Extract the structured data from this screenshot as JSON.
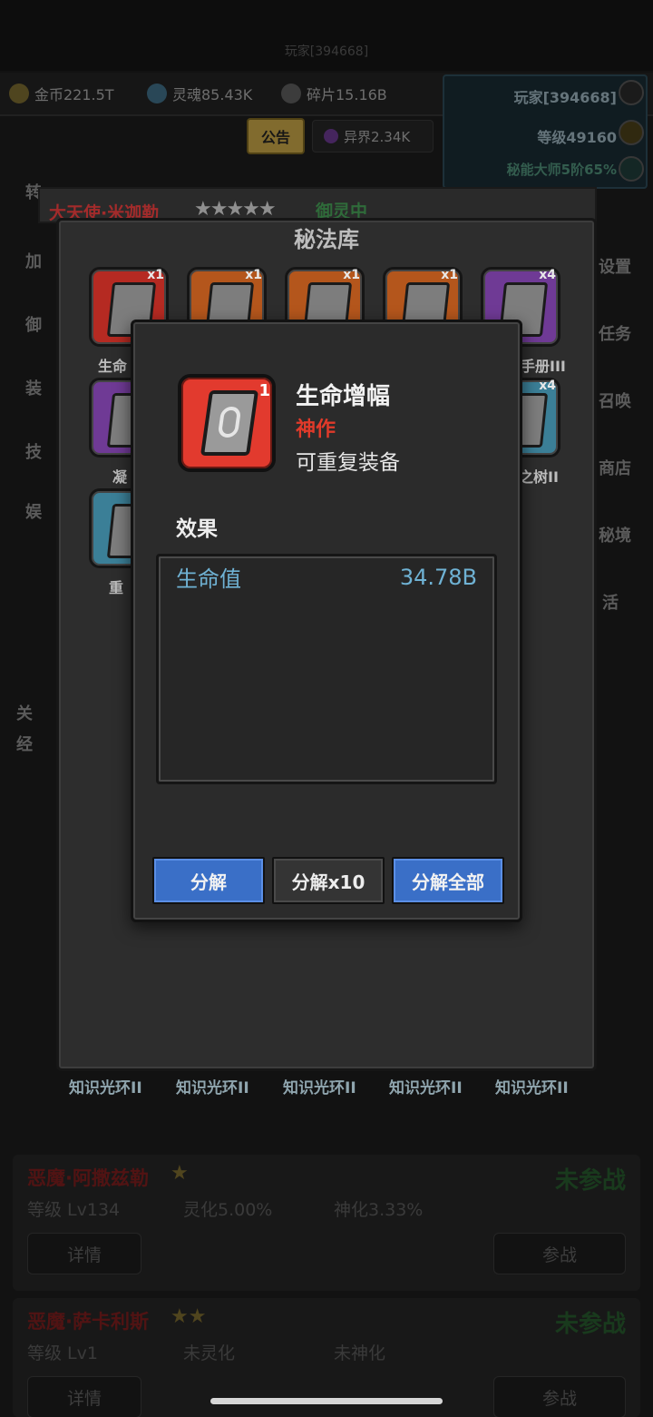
{
  "top": {
    "player_id_small": "玩家[394668]"
  },
  "resources": [
    {
      "icon": "gold-coin-icon",
      "label": "金币221.5T"
    },
    {
      "icon": "soul-icon",
      "label": "灵魂85.43K"
    },
    {
      "icon": "fragment-icon",
      "label": "碎片15.16B"
    }
  ],
  "notice_button": "公告",
  "otherworld": "异界2.34K",
  "player_panel": {
    "name": "玩家[394668]",
    "level": "等级49160",
    "title": "秘能大师5阶65%"
  },
  "side_left": [
    "转",
    "加",
    "御",
    "装",
    "技",
    "娱",
    "关",
    "经"
  ],
  "side_right": [
    "设置",
    "任务",
    "召唤",
    "商店",
    "秘境",
    "活"
  ],
  "bg_hero": {
    "name": "大天使·米迦勒",
    "stars": "★★★★★",
    "status": "御灵中"
  },
  "library": {
    "title": "秘法库",
    "slots": [
      {
        "color": "red",
        "count": "x1",
        "label": "生命"
      },
      {
        "color": "orange",
        "count": "x1",
        "label": ""
      },
      {
        "color": "orange",
        "count": "x1",
        "label": ""
      },
      {
        "color": "orange",
        "count": "x1",
        "label": ""
      },
      {
        "color": "purple",
        "count": "x4",
        "label": "手册III"
      },
      {
        "color": "purple",
        "count": "",
        "label": "凝"
      },
      {
        "color": "blue",
        "count": "x4",
        "label": "之树II"
      },
      {
        "color": "blue",
        "count": "",
        "label": "重"
      }
    ],
    "bottom_items": [
      "知识光环II",
      "知识光环II",
      "知识光环II",
      "知识光环II",
      "知识光环II"
    ]
  },
  "modal": {
    "item_count": "1",
    "item_name": "生命增幅",
    "item_grade": "神作",
    "item_repeat": "可重复装备",
    "effect_title": "效果",
    "stats": [
      {
        "name": "生命值",
        "value": "34.78B"
      }
    ],
    "buttons": {
      "decompose": "分解",
      "decompose_x10": "分解x10",
      "decompose_all": "分解全部"
    }
  },
  "heroes": [
    {
      "name": "恶魔·阿撒兹勒",
      "stars": "★",
      "status": "未参战",
      "level": "等级 Lv134",
      "spirit": "灵化5.00%",
      "divine": "神化3.33%",
      "detail": "详情",
      "join": "参战"
    },
    {
      "name": "恶魔·萨卡利斯",
      "stars": "★★",
      "status": "未参战",
      "level": "等级 Lv1",
      "spirit": "未灵化",
      "divine": "未神化",
      "detail": "详情",
      "join": "参战"
    }
  ],
  "colors": {
    "accent_blue": "#3a6fc7",
    "grade_red": "#e03a2a",
    "stat_blue": "#6fb2d4"
  }
}
